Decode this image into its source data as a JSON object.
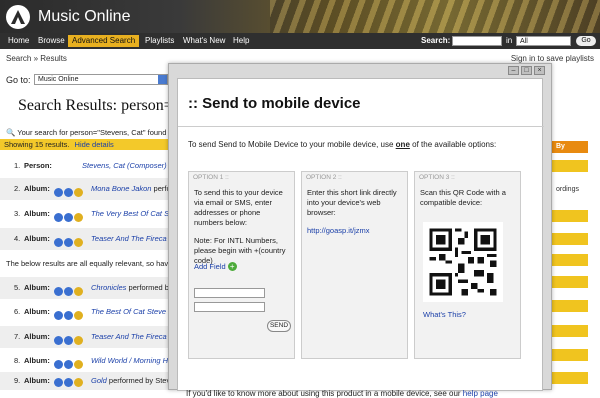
{
  "app": {
    "title": "Music Online"
  },
  "nav": {
    "items": [
      "Home",
      "Browse",
      "Advanced Search",
      "Playlists",
      "What's New",
      "Help"
    ],
    "search_label": "Search:",
    "in_label": "in",
    "in_value": "All",
    "go_label": "Go"
  },
  "breadcrumb": "Search » Results",
  "signin": "Sign in to save playlists",
  "goto": {
    "label": "Go to:",
    "value": "Music Online"
  },
  "results": {
    "title": "Search Results: person=",
    "your_search": "Your search for person=\"Stevens, Cat\" found",
    "showing": "Showing 15 results.",
    "hide_details": "Hide details",
    "relevance_note": "The below results are all equally relevant, so hav",
    "rows": [
      {
        "num": "1.",
        "type": "Person:",
        "name": "Stevens, Cat (Composer)",
        "extra": ""
      },
      {
        "num": "2.",
        "type": "Album:",
        "name": "Mona Bone Jakon",
        "extra": " perform"
      },
      {
        "num": "3.",
        "type": "Album:",
        "name": "The Very Best Of Cat S",
        "extra": ""
      },
      {
        "num": "4.",
        "type": "Album:",
        "name": "Teaser And The Fireca",
        "extra": ""
      },
      {
        "num": "5.",
        "type": "Album:",
        "name": "Chronicles",
        "extra": " performed b"
      },
      {
        "num": "6.",
        "type": "Album:",
        "name": "The Best Of Cat Steve",
        "extra": ""
      },
      {
        "num": "7.",
        "type": "Album:",
        "name": "Teaser And The Fireca",
        "extra": ""
      },
      {
        "num": "8.",
        "type": "Album:",
        "name": "Wild World / Morning H",
        "extra": ""
      },
      {
        "num": "9.",
        "type": "Album:",
        "name": "Gold",
        "extra": " performed by Stev"
      }
    ]
  },
  "right": {
    "sort_label": "By",
    "ordings": "ordings"
  },
  "dialog": {
    "title": ":: Send to mobile device",
    "intro_pre": "To send Send to Mobile Device to your mobile device, use ",
    "intro_bold": "one",
    "intro_post": " of the available options:",
    "option1": {
      "header": "OPTION 1 ::",
      "text": "To send this to your device via email or SMS, enter addresses or phone numbers below:",
      "note": "Note: For INTL Numbers, please begin with +(country code)",
      "add_field": "Add Field",
      "send": "SEND"
    },
    "option2": {
      "header": "OPTION 2 ::",
      "text": "Enter this short link directly into your device's web browser:",
      "link": "http://goasp.it/jzmx"
    },
    "option3": {
      "header": "OPTION 3 ::",
      "text": "Scan this QR Code with a compatible device:",
      "whats_this": "What's This?"
    },
    "footer_text": "If you'd like to know more about using this product in a mobile device, see our ",
    "footer_link": "help page"
  },
  "colors": {
    "accent": "#f0c41f",
    "link": "#1a3fa8",
    "nav_bg": "#2f2f2f"
  }
}
